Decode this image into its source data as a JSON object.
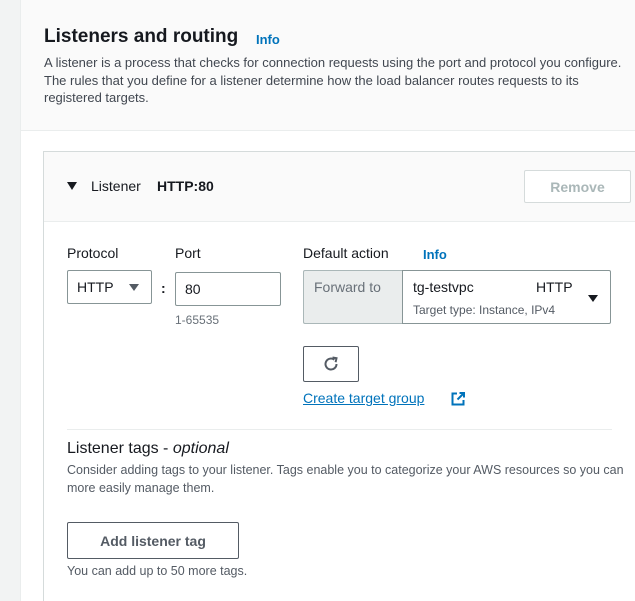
{
  "section": {
    "title": "Listeners and routing",
    "info": "Info",
    "description": "A listener is a process that checks for connection requests using the port and protocol you configure. The rules that you define for a listener determine how the load balancer routes requests to its registered targets."
  },
  "listener": {
    "label": "Listener",
    "value": "HTTP:80",
    "remove_label": "Remove",
    "protocol_label": "Protocol",
    "protocol_value": "HTTP",
    "colon": ":",
    "port_label": "Port",
    "port_value": "80",
    "port_hint": "1-65535",
    "default_action_label": "Default action",
    "default_action_info": "Info",
    "forward_to_label": "Forward to",
    "target_group": {
      "name": "tg-testvpc",
      "protocol": "HTTP",
      "type": "Target type: Instance, IPv4"
    },
    "create_target_group_link": "Create target group"
  },
  "tags": {
    "title": "Listener tags - ",
    "title_optional": "optional",
    "description": "Consider adding tags to your listener. Tags enable you to categorize your AWS resources so you can more easily manage them.",
    "add_button": "Add listener tag",
    "hint": "You can add up to 50 more tags."
  },
  "colors": {
    "link": "#0073bb",
    "text": "#16191f",
    "muted": "#545b64",
    "disabled": "#aab7b8"
  }
}
